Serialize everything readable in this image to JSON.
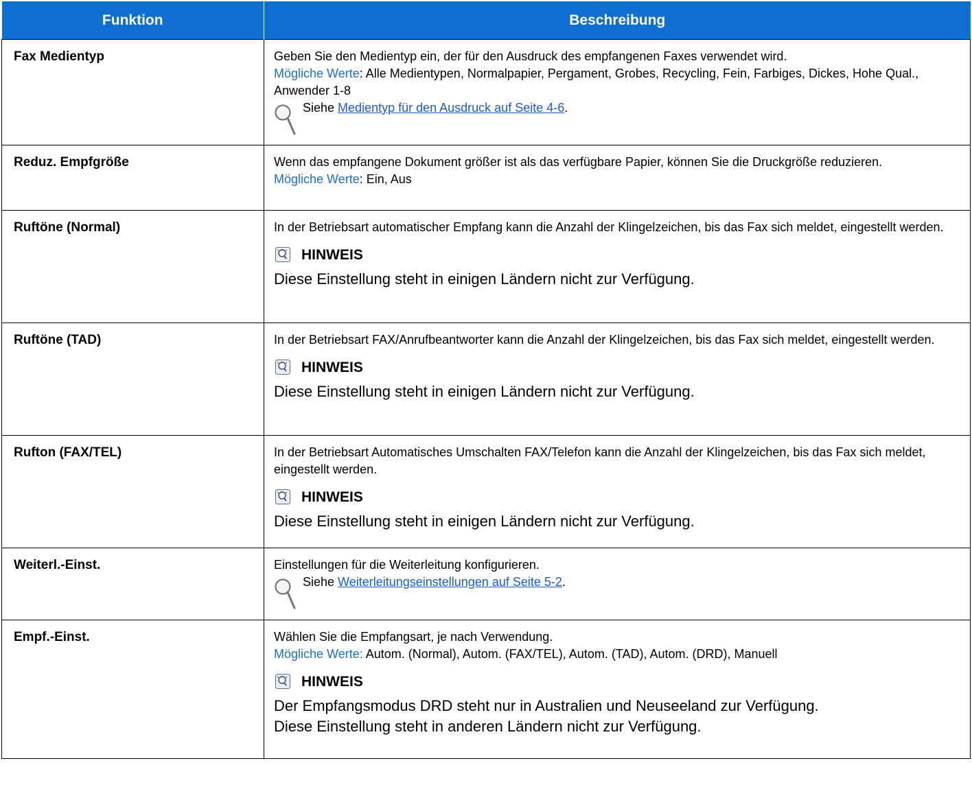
{
  "header": {
    "col1": "Funktion",
    "col2": "Beschreibung"
  },
  "rows": [
    {
      "func": "Fax Medientyp",
      "desc": "Geben Sie den Medientyp ein, der für den Ausdruck des empfangenen Faxes verwendet wird.",
      "values_label": "Mögliche Werte",
      "values": ": Alle Medientypen, Normalpapier, Pergament, Grobes, Recycling, Fein, Farbiges, Dickes, Hohe Qual., Anwender 1-8",
      "ref_prefix": "Siehe ",
      "ref_link": "Medientyp für den Ausdruck auf Seite 4-6",
      "ref_suffix": "."
    },
    {
      "func": "Reduz. Empfgröße",
      "desc": "Wenn das empfangene Dokument größer ist als das verfügbare Papier, können Sie die Druckgröße reduzieren.",
      "values_label": "Mögliche Werte",
      "values": ": Ein, Aus"
    },
    {
      "func": "Ruftöne (Normal)",
      "desc": "In der Betriebsart automatischer Empfang kann die Anzahl der Klingelzeichen, bis das Fax sich meldet, eingestellt werden.",
      "note_title": "HINWEIS",
      "note_text": "Diese Einstellung steht in einigen Ländern nicht zur Verfügung."
    },
    {
      "func": "Ruftöne (TAD)",
      "desc": "In der Betriebsart FAX/Anrufbeantworter kann die Anzahl der Klingelzeichen, bis das Fax sich meldet, eingestellt werden.",
      "note_title": "HINWEIS",
      "note_text": "Diese Einstellung steht in einigen Ländern nicht zur Verfügung."
    },
    {
      "func": "Rufton (FAX/TEL)",
      "desc": "In der Betriebsart Automatisches Umschalten FAX/Telefon kann die Anzahl der Klingelzeichen, bis das Fax sich meldet, eingestellt werden.",
      "note_title": "HINWEIS",
      "note_text": "Diese Einstellung steht in einigen Ländern nicht zur Verfügung."
    },
    {
      "func": "Weiterl.-Einst.",
      "desc": "Einstellungen für die Weiterleitung konfigurieren.",
      "ref_prefix": "Siehe ",
      "ref_link": "Weiterleitungseinstellungen auf Seite 5-2",
      "ref_suffix": "."
    },
    {
      "func": "Empf.-Einst.",
      "desc": "Wählen Sie die Empfangsart, je nach Verwendung.",
      "values_label": "Mögliche Werte:",
      "values": " Autom. (Normal), Autom. (FAX/TEL), Autom. (TAD), Autom. (DRD), Manuell",
      "note_title": "HINWEIS",
      "note_text_1": "Der Empfangsmodus DRD steht nur in Australien und Neuseeland zur Verfügung.",
      "note_text_2": "Diese Einstellung steht in anderen Ländern nicht zur Verfügung."
    }
  ],
  "icons": {
    "reference": "magnifier-icon",
    "note": "lightbulb-note-icon"
  },
  "colors": {
    "header_bg": "#0d6fd1",
    "possible_values": "#1a6fd8",
    "link": "#1a5bd8"
  }
}
